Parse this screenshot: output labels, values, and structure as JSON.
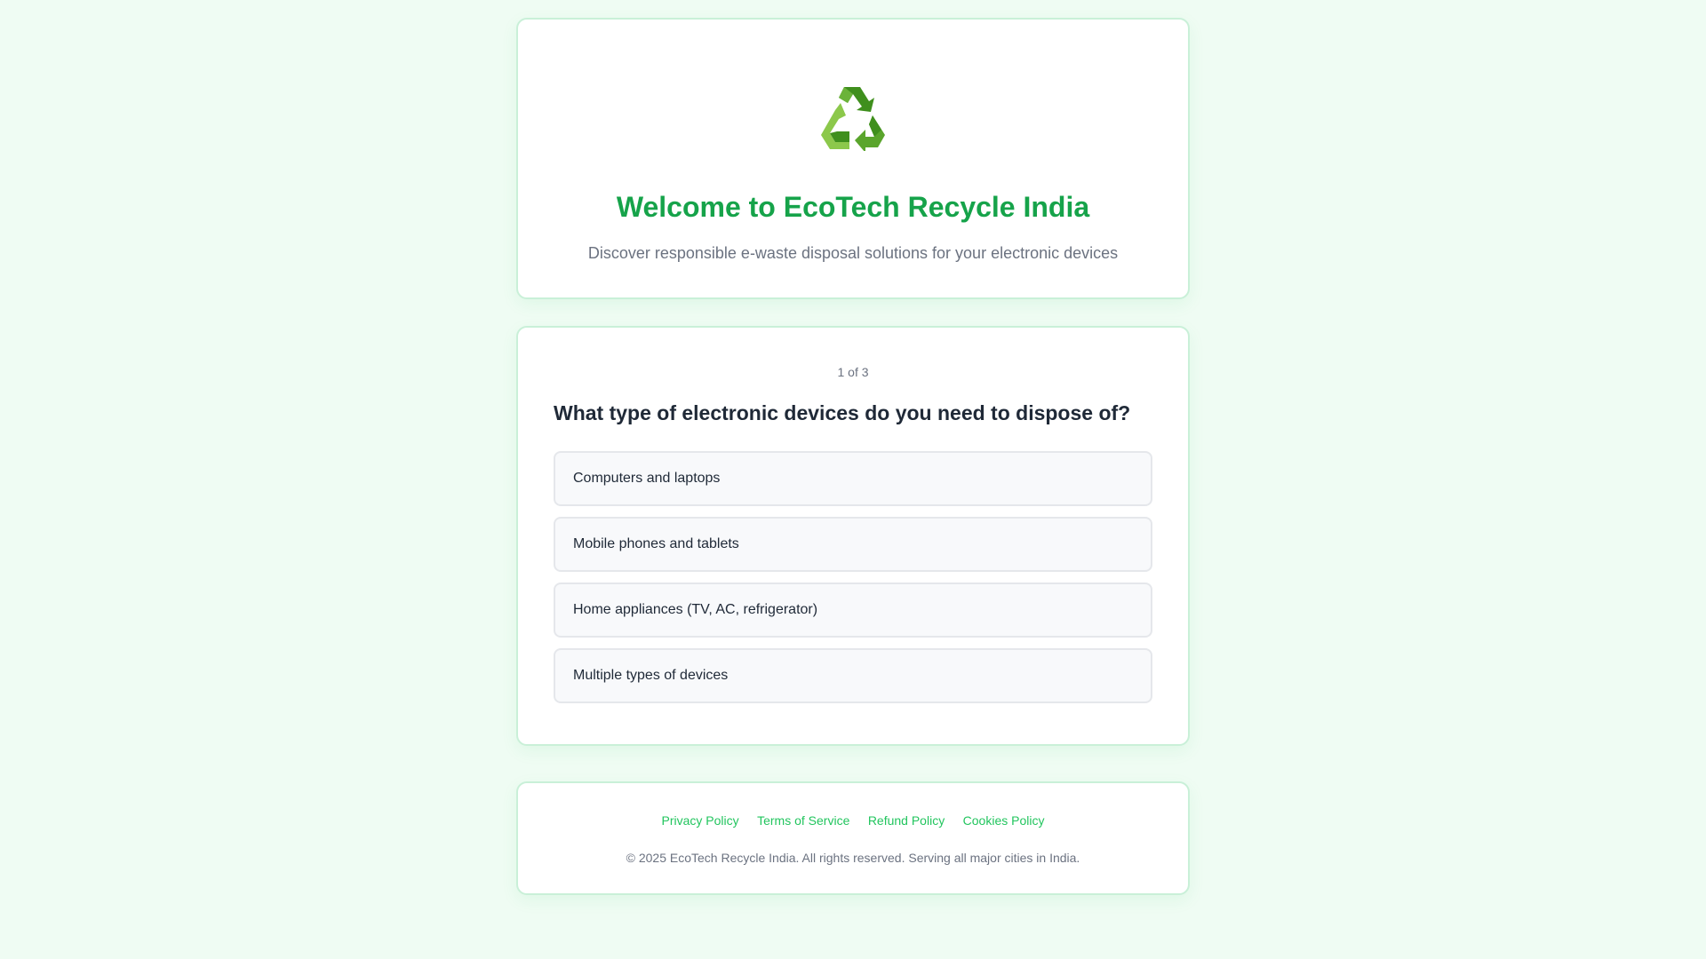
{
  "hero": {
    "logo_icon": "recycle-icon",
    "title": "Welcome to EcoTech Recycle India",
    "subtitle": "Discover responsible e-waste disposal solutions for your electronic devices"
  },
  "quiz": {
    "progress": "1 of 3",
    "question": "What type of electronic devices do you need to dispose of?",
    "options": [
      "Computers and laptops",
      "Mobile phones and tablets",
      "Home appliances (TV, AC, refrigerator)",
      "Multiple types of devices"
    ]
  },
  "footer": {
    "links": [
      "Privacy Policy",
      "Terms of Service",
      "Refund Policy",
      "Cookies Policy"
    ],
    "copyright": "© 2025 EcoTech Recycle India. All rights reserved. Serving all major cities in India."
  },
  "colors": {
    "accent": "#16a34a",
    "link": "#22c55e",
    "background": "#effcf3",
    "border": "#c9f0d8"
  }
}
